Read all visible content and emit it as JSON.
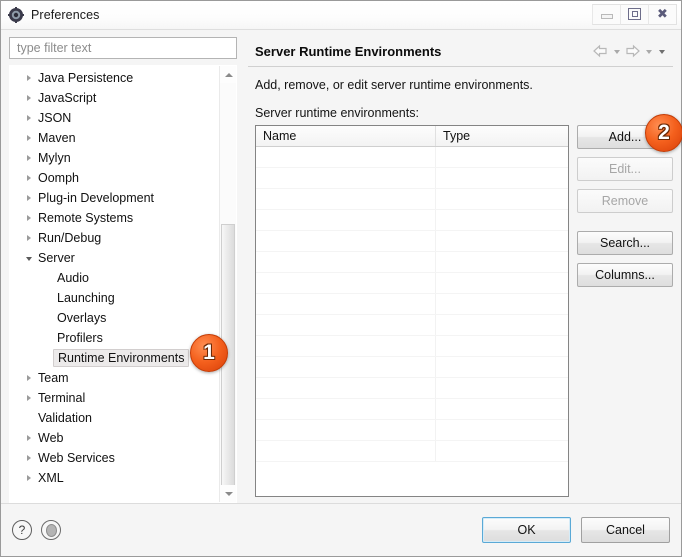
{
  "window": {
    "title": "Preferences",
    "icon": "gear-icon",
    "controls": {
      "minimize": "minimize-icon",
      "maximize": "restore-icon",
      "close": "close-icon"
    }
  },
  "filter": {
    "placeholder": "type filter text",
    "value": ""
  },
  "tree": {
    "items": [
      {
        "label": "Java Persistence",
        "twisty": "collapsed",
        "level": 0,
        "selected": false
      },
      {
        "label": "JavaScript",
        "twisty": "collapsed",
        "level": 0,
        "selected": false
      },
      {
        "label": "JSON",
        "twisty": "collapsed",
        "level": 0,
        "selected": false
      },
      {
        "label": "Maven",
        "twisty": "collapsed",
        "level": 0,
        "selected": false
      },
      {
        "label": "Mylyn",
        "twisty": "collapsed",
        "level": 0,
        "selected": false
      },
      {
        "label": "Oomph",
        "twisty": "collapsed",
        "level": 0,
        "selected": false
      },
      {
        "label": "Plug-in Development",
        "twisty": "collapsed",
        "level": 0,
        "selected": false
      },
      {
        "label": "Remote Systems",
        "twisty": "collapsed",
        "level": 0,
        "selected": false
      },
      {
        "label": "Run/Debug",
        "twisty": "collapsed",
        "level": 0,
        "selected": false
      },
      {
        "label": "Server",
        "twisty": "expanded",
        "level": 0,
        "selected": false
      },
      {
        "label": "Audio",
        "twisty": "none",
        "level": 1,
        "selected": false
      },
      {
        "label": "Launching",
        "twisty": "none",
        "level": 1,
        "selected": false
      },
      {
        "label": "Overlays",
        "twisty": "none",
        "level": 1,
        "selected": false
      },
      {
        "label": "Profilers",
        "twisty": "none",
        "level": 1,
        "selected": false
      },
      {
        "label": "Runtime Environments",
        "twisty": "none",
        "level": 1,
        "selected": true
      },
      {
        "label": "Team",
        "twisty": "collapsed",
        "level": 0,
        "selected": false
      },
      {
        "label": "Terminal",
        "twisty": "collapsed",
        "level": 0,
        "selected": false
      },
      {
        "label": "Validation",
        "twisty": "none",
        "level": 0,
        "selected": false
      },
      {
        "label": "Web",
        "twisty": "collapsed",
        "level": 0,
        "selected": false
      },
      {
        "label": "Web Services",
        "twisty": "collapsed",
        "level": 0,
        "selected": false
      },
      {
        "label": "XML",
        "twisty": "collapsed",
        "level": 0,
        "selected": false
      }
    ],
    "scrollbar": {
      "up": "scroll-up-arrow",
      "down": "scroll-down-arrow"
    }
  },
  "page": {
    "title": "Server Runtime Environments",
    "description": "Add, remove, or edit server runtime environments.",
    "list_label": "Server runtime environments:",
    "nav": {
      "back": "back-arrow-icon",
      "back_menu": "back-dropdown-icon",
      "forward": "forward-arrow-icon",
      "forward_menu": "forward-dropdown-icon",
      "menu": "view-menu-icon"
    }
  },
  "table": {
    "columns": [
      "Name",
      "Type"
    ],
    "rows": [],
    "empty_row_count": 15
  },
  "buttons": [
    {
      "label": "Add...",
      "name": "add-button",
      "disabled": false
    },
    {
      "label": "Edit...",
      "name": "edit-button",
      "disabled": true
    },
    {
      "label": "Remove",
      "name": "remove-button",
      "disabled": true
    },
    {
      "label": "Search...",
      "name": "search-button",
      "disabled": false
    },
    {
      "label": "Columns...",
      "name": "columns-button",
      "disabled": false
    }
  ],
  "footer": {
    "help_icon": "help-question-icon",
    "record_icon": "record-circle-icon",
    "ok": "OK",
    "cancel": "Cancel"
  },
  "annotations": [
    {
      "number": "1",
      "target": "tree-item-runtime-environments"
    },
    {
      "number": "2",
      "target": "add-button"
    }
  ],
  "colors": {
    "accent": "#5aa9d6",
    "badge": "#f4601d",
    "dialog_bg": "#f5f5f5"
  }
}
